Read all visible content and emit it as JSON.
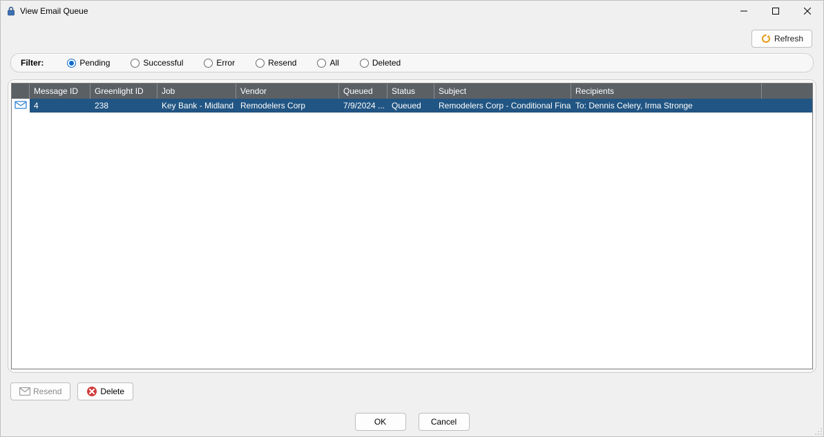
{
  "window": {
    "title": "View Email Queue"
  },
  "actions": {
    "refresh": "Refresh",
    "resend": "Resend",
    "delete": "Delete",
    "ok": "OK",
    "cancel": "Cancel"
  },
  "filter": {
    "label": "Filter:",
    "options": {
      "pending": {
        "label": "Pending",
        "selected": true
      },
      "successful": {
        "label": "Successful",
        "selected": false
      },
      "error": {
        "label": "Error",
        "selected": false
      },
      "resend": {
        "label": "Resend",
        "selected": false
      },
      "all": {
        "label": "All",
        "selected": false
      },
      "deleted": {
        "label": "Deleted",
        "selected": false
      }
    }
  },
  "columns": {
    "message_id": "Message ID",
    "greenlight_id": "Greenlight ID",
    "job": "Job",
    "vendor": "Vendor",
    "queued": "Queued",
    "status": "Status",
    "subject": "Subject",
    "recipients": "Recipients"
  },
  "rows": [
    {
      "message_id": "4",
      "greenlight_id": "238",
      "job": "Key Bank - Midland",
      "vendor": "Remodelers Corp",
      "queued": "7/9/2024 ...",
      "status": "Queued",
      "subject": "Remodelers Corp - Conditional Final W...",
      "recipients": "To: Dennis Celery, Irma Stronge"
    }
  ]
}
